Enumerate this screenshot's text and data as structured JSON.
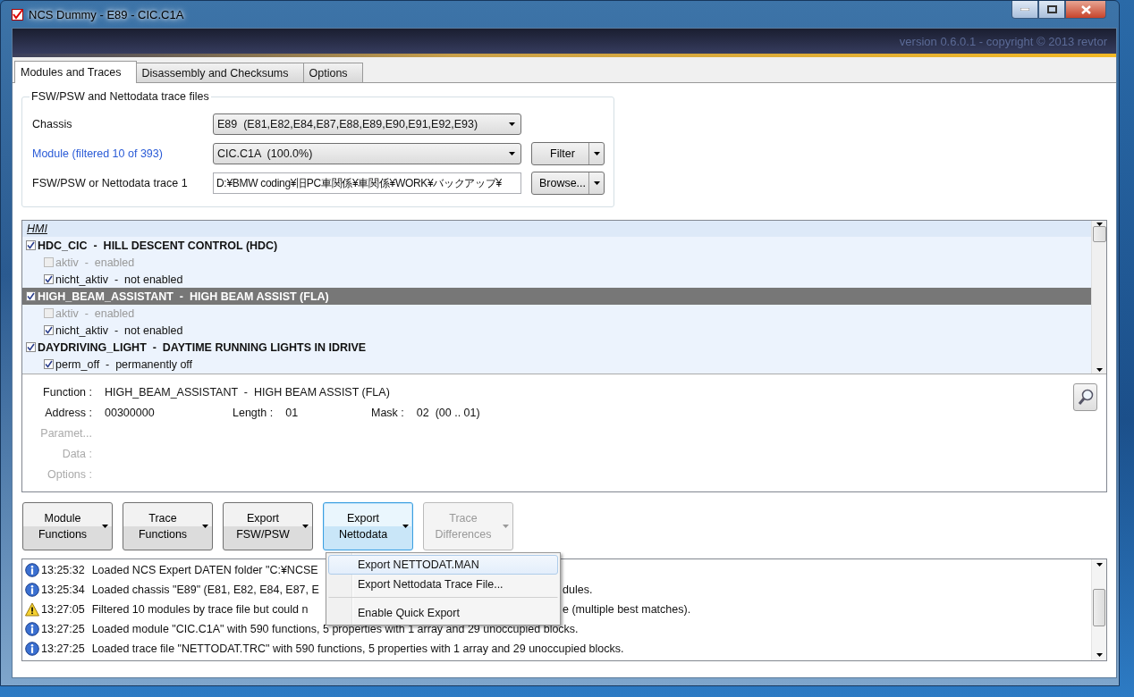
{
  "window": {
    "title": "NCS Dummy - E89 - CIC.C1A",
    "version": "version 0.6.0.1 - copyright © 2013 revtor"
  },
  "tabs": [
    {
      "label": "Modules and Traces",
      "selected": true
    },
    {
      "label": "Disassembly and Checksums",
      "selected": false
    },
    {
      "label": "Options",
      "selected": false
    }
  ],
  "trace_files": {
    "title": "FSW/PSW and Nettodata trace files",
    "rows": [
      {
        "label": "Chassis",
        "link": false,
        "value": "E89  (E81,E82,E84,E87,E88,E89,E90,E91,E92,E93)",
        "kind": "combo"
      },
      {
        "label": "Module (filtered 10 of 393)",
        "link": true,
        "value": "CIC.C1A  (100.0%)",
        "kind": "combo",
        "button": "Filter"
      },
      {
        "label": "FSW/PSW or Nettodata trace 1",
        "link": false,
        "value": "D:¥BMW coding¥旧PC車関係¥車関係¥WORK¥バックアップ¥",
        "kind": "text",
        "button": "Browse..."
      }
    ]
  },
  "functions": {
    "group": "HMI",
    "items": [
      {
        "label": "HDC_CIC  -  HILL DESCENT CONTROL (HDC)",
        "checked": true,
        "selected": false,
        "children": [
          {
            "label": "aktiv  -  enabled",
            "checked": false,
            "disabled": true
          },
          {
            "label": "nicht_aktiv  -  not enabled",
            "checked": true,
            "disabled": false
          }
        ]
      },
      {
        "label": "HIGH_BEAM_ASSISTANT  -  HIGH BEAM ASSIST (FLA)",
        "checked": true,
        "selected": true,
        "children": [
          {
            "label": "aktiv  -  enabled",
            "checked": false,
            "disabled": true
          },
          {
            "label": "nicht_aktiv  -  not enabled",
            "checked": true,
            "disabled": false
          }
        ]
      },
      {
        "label": "DAYDRIVING_LIGHT  -  DAYTIME RUNNING LIGHTS IN IDRIVE",
        "checked": true,
        "selected": false,
        "children": [
          {
            "label": "perm_off  -  permanently off",
            "checked": true,
            "disabled": false
          }
        ]
      }
    ]
  },
  "details": [
    [
      {
        "label": "Function :",
        "value": "HIGH_BEAM_ASSISTANT  -  HIGH BEAM ASSIST (FLA)",
        "disabled": false
      }
    ],
    [
      {
        "label": "Address :",
        "value": "00300000",
        "disabled": false
      },
      {
        "label": "Length :",
        "value": "01",
        "disabled": false
      },
      {
        "label": "Mask :",
        "value": "02  (00 .. 01)",
        "disabled": false
      }
    ],
    [
      {
        "label": "Paramet...",
        "disabled": true
      }
    ],
    [
      {
        "label": "Data :",
        "disabled": true
      }
    ],
    [
      {
        "label": "Options :",
        "disabled": true
      }
    ]
  ],
  "actions": [
    {
      "line1": "Module",
      "line2": "Functions",
      "disabled": false,
      "open": false
    },
    {
      "line1": "Trace",
      "line2": "Functions",
      "disabled": false,
      "open": false
    },
    {
      "line1": "Export",
      "line2": "FSW/PSW",
      "disabled": false,
      "open": false
    },
    {
      "line1": "Export",
      "line2": "Nettodata",
      "disabled": false,
      "open": true
    },
    {
      "line1": "Trace",
      "line2": "Differences",
      "disabled": true,
      "open": false
    }
  ],
  "menu": [
    {
      "label": "Export NETTODAT.MAN",
      "selected": true,
      "separator_before": false
    },
    {
      "label": "Export Nettodata Trace File...",
      "selected": false,
      "separator_before": false
    },
    {
      "label": "Enable Quick Export",
      "selected": false,
      "separator_before": true
    }
  ],
  "log": [
    {
      "kind": "info",
      "time": "13:25:32",
      "text": "Loaded NCS Expert DATEN folder \"C:¥NCSE"
    },
    {
      "kind": "info",
      "time": "13:25:34",
      "text": "Loaded chassis \"E89\" (E81, E82, E84, E87, E",
      "text_after": "dules."
    },
    {
      "kind": "warning",
      "time": "13:27:05",
      "text": "Filtered 10 modules by trace file but could n",
      "text_after": "e (multiple best matches)."
    },
    {
      "kind": "info",
      "time": "13:27:25",
      "text": "Loaded module \"CIC.C1A\" with 590 functions, 5 properties with 1 array and 29 unoccupied blocks."
    },
    {
      "kind": "info",
      "time": "13:27:25",
      "text": "Loaded trace file \"NETTODAT.TRC\" with 590 functions, 5 properties with 1 array and 29 unoccupied blocks."
    }
  ]
}
